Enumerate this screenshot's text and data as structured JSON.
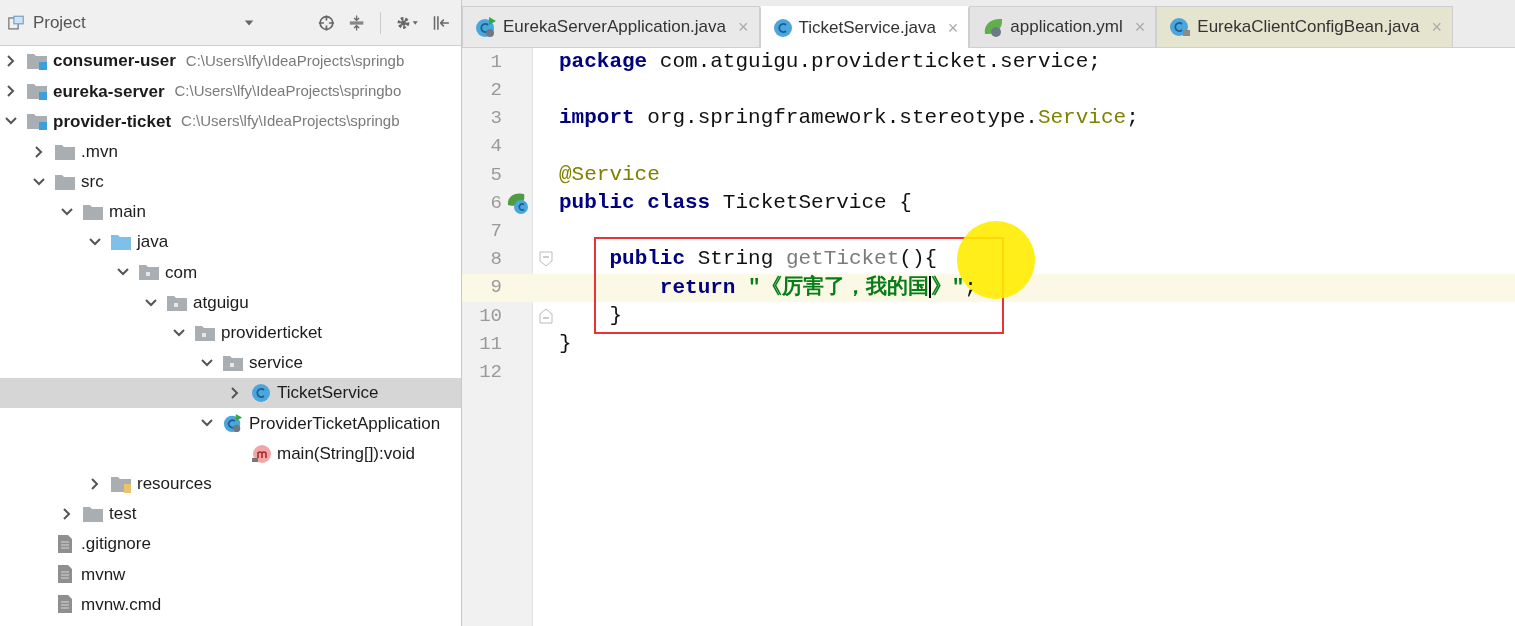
{
  "project_panel": {
    "title": "Project",
    "tree": [
      {
        "label": "consumer-user",
        "path": "C:\\Users\\lfy\\IdeaProjects\\springb",
        "kind": "module",
        "expanded": false,
        "selected": false
      },
      {
        "label": "eureka-server",
        "path": "C:\\Users\\lfy\\IdeaProjects\\springbo",
        "kind": "module",
        "expanded": false,
        "selected": false
      },
      {
        "label": "provider-ticket",
        "path": "C:\\Users\\lfy\\IdeaProjects\\springb",
        "kind": "module",
        "expanded": true,
        "selected": false,
        "children": [
          {
            "label": ".mvn",
            "kind": "folder",
            "expanded": false,
            "selected": false
          },
          {
            "label": "src",
            "kind": "folder",
            "expanded": true,
            "selected": false,
            "children": [
              {
                "label": "main",
                "kind": "folder",
                "expanded": true,
                "selected": false,
                "children": [
                  {
                    "label": "java",
                    "kind": "source",
                    "expanded": true,
                    "selected": false,
                    "children": [
                      {
                        "label": "com",
                        "kind": "package",
                        "expanded": true,
                        "selected": false,
                        "children": [
                          {
                            "label": "atguigu",
                            "kind": "package",
                            "expanded": true,
                            "selected": false,
                            "children": [
                              {
                                "label": "providerticket",
                                "kind": "package",
                                "expanded": true,
                                "selected": false,
                                "children": [
                                  {
                                    "label": "service",
                                    "kind": "package",
                                    "expanded": true,
                                    "selected": false,
                                    "children": [
                                      {
                                        "label": "TicketService",
                                        "kind": "class",
                                        "expanded": false,
                                        "selected": true
                                      }
                                    ]
                                  },
                                  {
                                    "label": "ProviderTicketApplication",
                                    "kind": "spring_app",
                                    "expanded": true,
                                    "selected": false,
                                    "children": [
                                      {
                                        "label": "main(String[]):void",
                                        "kind": "method",
                                        "selected": false
                                      }
                                    ]
                                  }
                                ]
                              }
                            ]
                          }
                        ]
                      }
                    ]
                  },
                  {
                    "label": "resources",
                    "kind": "resources",
                    "expanded": false,
                    "selected": false
                  }
                ]
              },
              {
                "label": "test",
                "kind": "folder",
                "expanded": false,
                "selected": false
              }
            ]
          },
          {
            "label": ".gitignore",
            "kind": "file",
            "selected": false
          },
          {
            "label": "mvnw",
            "kind": "file",
            "selected": false
          },
          {
            "label": "mvnw.cmd",
            "kind": "file",
            "selected": false
          }
        ]
      }
    ]
  },
  "tabs": [
    {
      "label": "EurekaServerApplication.java",
      "kind": "spring_app",
      "close": "×",
      "selected": false,
      "color": "#e9e9e9"
    },
    {
      "label": "TicketService.java",
      "kind": "class",
      "close": "×",
      "selected": true,
      "color": "#ffffff"
    },
    {
      "label": "application.yml",
      "kind": "yml",
      "close": "×",
      "selected": false,
      "color": "#e4e4e4"
    },
    {
      "label": "EurekaClientConfigBean.java",
      "kind": "class_locked",
      "close": "×",
      "selected": false,
      "color": "#e5e5cf"
    }
  ],
  "editor": {
    "lines": [
      {
        "number": "1",
        "tokens": [
          {
            "kind": "keyword",
            "text": "package"
          },
          {
            "kind": "plain",
            "text": " com.atguigu.providerticket.service;"
          }
        ]
      },
      {
        "number": "2"
      },
      {
        "number": "3",
        "tokens": [
          {
            "kind": "keyword",
            "text": "import"
          },
          {
            "kind": "plain",
            "text": " org.springframework.stereotype."
          },
          {
            "kind": "annotation",
            "text": "Service"
          },
          {
            "kind": "plain",
            "text": ";"
          }
        ]
      },
      {
        "number": "4"
      },
      {
        "number": "5",
        "tokens": [
          {
            "kind": "annotation",
            "text": "@Service"
          }
        ]
      },
      {
        "number": "6",
        "kind": "spring_class",
        "tokens": [
          {
            "kind": "keyword",
            "text": "public class"
          },
          {
            "kind": "plain",
            "text": " TicketService {"
          }
        ]
      },
      {
        "number": "7"
      },
      {
        "number": "8",
        "fold_start": true,
        "boxed": true,
        "pointer_spot": true,
        "tokens": [
          {
            "kind": "keyword",
            "text": "    public"
          },
          {
            "kind": "plain",
            "text": " String "
          },
          {
            "kind": "unused",
            "text": "getTicket"
          },
          {
            "kind": "plain",
            "text": "(){"
          }
        ]
      },
      {
        "number": "9",
        "current": true,
        "boxed": true,
        "tokens": [
          {
            "kind": "keyword",
            "text": "        return"
          },
          {
            "kind": "string",
            "text": " \"《厉害了，我的国",
            "caret_after": true
          },
          {
            "kind": "string",
            "text": "》\""
          },
          {
            "kind": "plain",
            "text": ";"
          }
        ]
      },
      {
        "number": "10",
        "fold_end": true,
        "boxed": true,
        "tokens": [
          {
            "kind": "plain",
            "text": "    }"
          }
        ]
      },
      {
        "number": "11",
        "tokens": [
          {
            "kind": "plain",
            "text": "}"
          }
        ]
      },
      {
        "number": "12"
      }
    ]
  }
}
